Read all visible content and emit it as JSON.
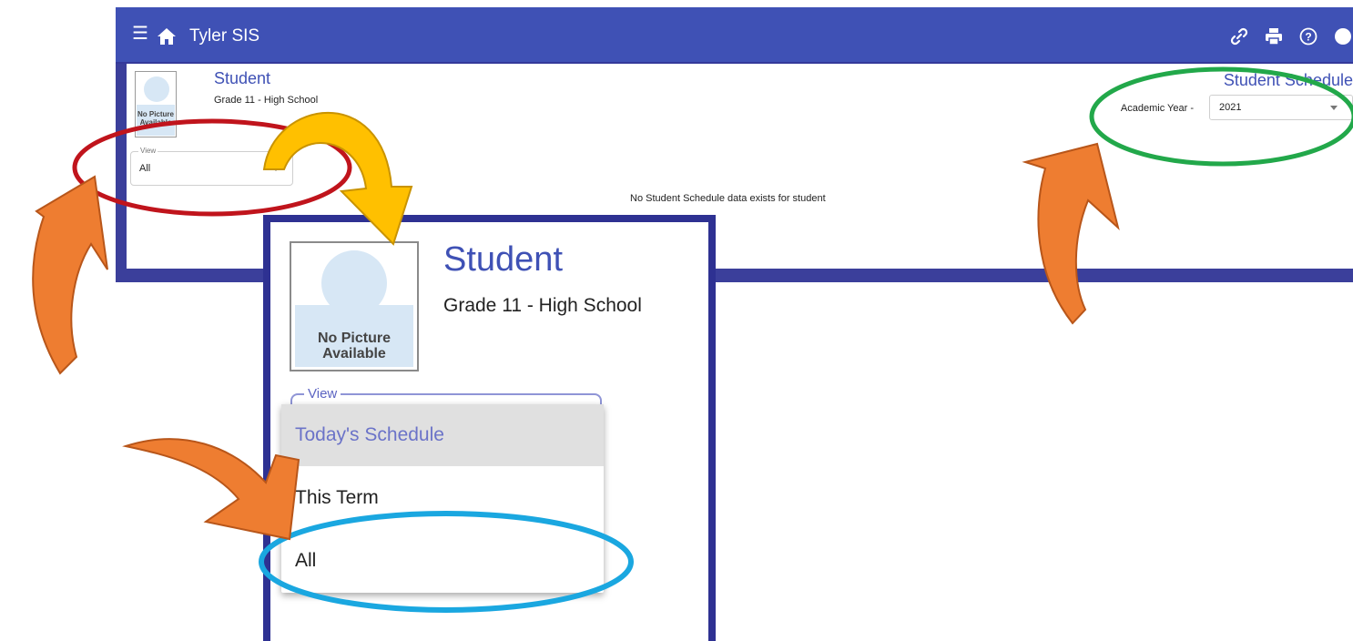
{
  "topbar": {
    "menu_icon": "menu-icon",
    "home_icon": "home-icon",
    "title": "Tyler SIS",
    "icons": [
      "link-icon",
      "print-icon",
      "help-icon",
      "user-circle-icon"
    ]
  },
  "student": {
    "name": "Student",
    "grade": "Grade 11 - High School",
    "no_picture": "No Picture Available"
  },
  "view": {
    "label": "View",
    "value": "All"
  },
  "schedule": {
    "title": "Student Schedule",
    "academic_year_label": "Academic Year -",
    "academic_year_value": "2021",
    "empty_message": "No Student Schedule data exists for student"
  },
  "zoom": {
    "name": "Student",
    "grade": "Grade 11 - High School",
    "no_picture": "No Picture Available",
    "view_label": "View",
    "options": [
      "Today's Schedule",
      "This Term",
      "All"
    ],
    "selected_option": "Today's Schedule"
  },
  "colors": {
    "brand": "#3f51b5",
    "frame": "#2e3192",
    "highlight_red": "#c0141c",
    "highlight_green": "#22a84a",
    "highlight_blue": "#1aa7e0",
    "arrow_orange": "#ee7d31",
    "arrow_yellow": "#ffc000"
  }
}
